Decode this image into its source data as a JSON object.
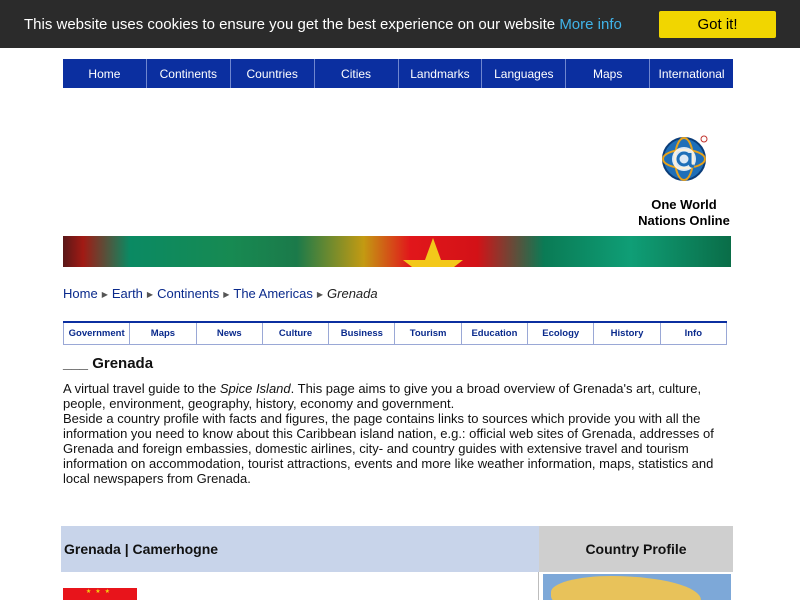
{
  "cookie": {
    "message": "This website uses cookies to ensure you get the best experience on our website ",
    "link_label": "More info",
    "button_label": "Got it!"
  },
  "top_nav": {
    "items": [
      "Home",
      "Continents",
      "Countries",
      "Cities",
      "Landmarks",
      "Languages",
      "Maps",
      "International"
    ]
  },
  "brand": {
    "line1": "One World",
    "line2": "Nations Online"
  },
  "breadcrumb": {
    "items": [
      "Home",
      "Earth",
      "Continents",
      "The Americas"
    ],
    "current": "Grenada"
  },
  "sub_nav": {
    "items": [
      "Government",
      "Maps",
      "News",
      "Culture",
      "Business",
      "Tourism",
      "Education",
      "Ecology",
      "History",
      "Info"
    ]
  },
  "page": {
    "title_prefix": "___",
    "title": "Grenada",
    "intro_p1_before": "A virtual travel guide to the ",
    "intro_p1_em": "Spice Island",
    "intro_p1_after": ". This page aims to give you a broad overview of Grenada's art, culture, people, environment, geography, history, economy and government.",
    "intro_p2": "Beside a country profile with facts and figures, the page contains links to sources which provide you with all the information you need to know about this Caribbean island nation, e.g.: official web sites of Grenada, addresses of Grenada and foreign embassies, domestic airlines, city- and country guides with extensive travel and tourism information on accommodation, tourist attractions, events and more like weather information, maps, statistics and local newspapers from Grenada."
  },
  "info_table": {
    "left_header": "Grenada | Camerhogne",
    "right_header": "Country Profile"
  },
  "colors": {
    "cookie_bg": "#2b2b2b",
    "cookie_button": "#f1d600",
    "nav_blue": "#0b2fa0",
    "link_blue": "#0a2a8c"
  }
}
